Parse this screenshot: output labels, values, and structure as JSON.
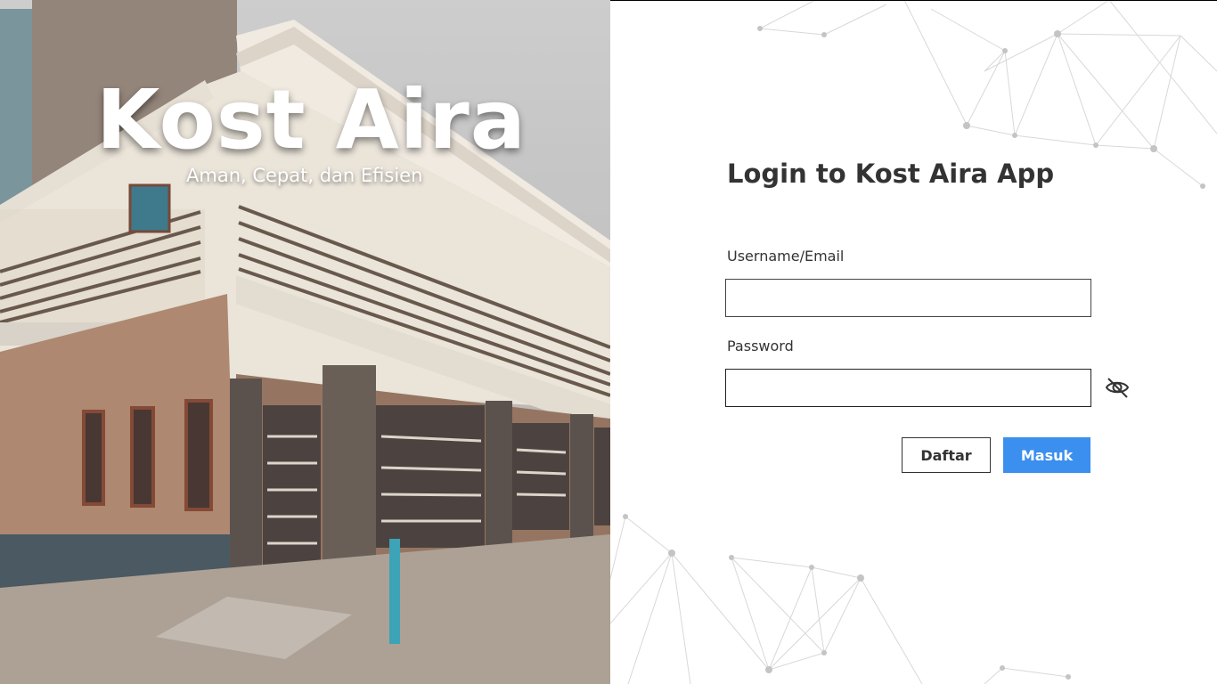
{
  "hero": {
    "title": "Kost Aira",
    "tagline": "Aman, Cepat, dan Efisien"
  },
  "login": {
    "title": "Login to Kost Aira App",
    "username_label": "Username/Email",
    "username_value": "",
    "password_label": "Password",
    "password_value": "",
    "register_label": "Daftar",
    "submit_label": "Masuk",
    "password_toggle_icon": "eye-slash-icon"
  },
  "colors": {
    "primary": "#3b8fee",
    "text": "#333333",
    "background": "#ffffff"
  }
}
